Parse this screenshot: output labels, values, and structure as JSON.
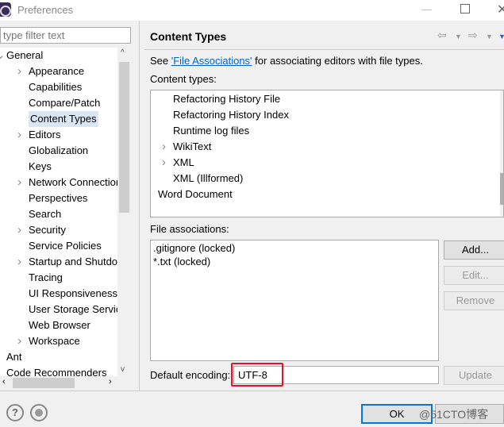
{
  "window": {
    "title": "Preferences"
  },
  "filter": {
    "placeholder": "type filter text"
  },
  "tree": [
    {
      "label": "General",
      "level": 0,
      "arrow": "expanded"
    },
    {
      "label": "Appearance",
      "level": 1,
      "arrow": "collapsed"
    },
    {
      "label": "Capabilities",
      "level": 1,
      "arrow": ""
    },
    {
      "label": "Compare/Patch",
      "level": 1,
      "arrow": ""
    },
    {
      "label": "Content Types",
      "level": 1,
      "arrow": "",
      "selected": true
    },
    {
      "label": "Editors",
      "level": 1,
      "arrow": "collapsed"
    },
    {
      "label": "Globalization",
      "level": 1,
      "arrow": ""
    },
    {
      "label": "Keys",
      "level": 1,
      "arrow": ""
    },
    {
      "label": "Network Connections",
      "level": 1,
      "arrow": "collapsed"
    },
    {
      "label": "Perspectives",
      "level": 1,
      "arrow": ""
    },
    {
      "label": "Search",
      "level": 1,
      "arrow": ""
    },
    {
      "label": "Security",
      "level": 1,
      "arrow": "collapsed"
    },
    {
      "label": "Service Policies",
      "level": 1,
      "arrow": ""
    },
    {
      "label": "Startup and Shutdown",
      "level": 1,
      "arrow": "collapsed"
    },
    {
      "label": "Tracing",
      "level": 1,
      "arrow": ""
    },
    {
      "label": "UI Responsiveness",
      "level": 1,
      "arrow": ""
    },
    {
      "label": "User Storage Service",
      "level": 1,
      "arrow": ""
    },
    {
      "label": "Web Browser",
      "level": 1,
      "arrow": ""
    },
    {
      "label": "Workspace",
      "level": 1,
      "arrow": "collapsed"
    },
    {
      "label": "Ant",
      "level": 0,
      "arrow": "collapsed"
    },
    {
      "label": "Code Recommenders",
      "level": 0,
      "arrow": "collapsed"
    }
  ],
  "page": {
    "title": "Content Types",
    "see_prefix": "See ",
    "see_link": "'File Associations'",
    "see_suffix": " for associating editors with file types.",
    "content_types_label": "Content types:",
    "content_types": [
      {
        "label": "Refactoring History File",
        "level": 2,
        "arrow": ""
      },
      {
        "label": "Refactoring History Index",
        "level": 2,
        "arrow": ""
      },
      {
        "label": "Runtime log files",
        "level": 2,
        "arrow": ""
      },
      {
        "label": "WikiText",
        "level": 2,
        "arrow": "collapsed"
      },
      {
        "label": "XML",
        "level": 2,
        "arrow": "collapsed"
      },
      {
        "label": "XML (Illformed)",
        "level": 2,
        "arrow": ""
      },
      {
        "label": "Word Document",
        "level": 1,
        "arrow": ""
      }
    ],
    "file_assoc_label": "File associations:",
    "file_associations": [
      ".gitignore (locked)",
      "*.txt (locked)"
    ],
    "add": "Add...",
    "edit": "Edit...",
    "remove": "Remove",
    "encoding_label": "Default encoding:",
    "encoding_value": "UTF-8",
    "update": "Update"
  },
  "footer": {
    "ok": "OK",
    "help_icon": "?",
    "watermark": "@51CTO博客"
  },
  "colors": {
    "highlight": "#e81123",
    "selection": "#dbe6f4",
    "link": "#0066cc"
  }
}
